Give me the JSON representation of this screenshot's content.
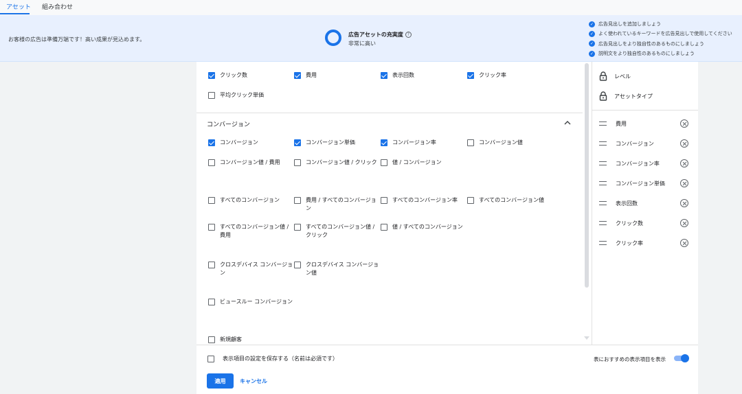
{
  "tabs": [
    {
      "label": "アセット",
      "active": true
    },
    {
      "label": "組み合わせ",
      "active": false
    }
  ],
  "banner": {
    "message": "お客様の広告は準備万端です！高い成果が見込めます。",
    "strength_title": "広告アセットの充実度",
    "help_glyph": "?",
    "strength_value": "非常に高い",
    "tips": [
      "広告見出しを追加しましょう",
      "よく使われているキーワードを広告見出しで使用してください",
      "広告見出しをより独自性のあるものにしましょう",
      "説明文をより独自性のあるものにしましょう"
    ],
    "accent_color": "#1a73e8"
  },
  "performance_metrics": [
    {
      "label": "クリック数",
      "checked": true
    },
    {
      "label": "費用",
      "checked": true
    },
    {
      "label": "表示回数",
      "checked": true
    },
    {
      "label": "クリック率",
      "checked": true
    },
    {
      "label": "平均クリック単価",
      "checked": false
    }
  ],
  "conversion_section": {
    "title": "コンバージョン",
    "expanded": true,
    "items": [
      {
        "label": "コンバージョン",
        "checked": true
      },
      {
        "label": "コンバージョン単価",
        "checked": true
      },
      {
        "label": "コンバージョン率",
        "checked": true
      },
      {
        "label": "コンバージョン値",
        "checked": false
      },
      {
        "label": "コンバージョン値 / 費用",
        "checked": false
      },
      {
        "label": "コンバージョン値 / クリック",
        "checked": false
      },
      {
        "label": "値 / コンバージョン",
        "checked": false
      },
      {
        "label": "すべてのコンバージョン",
        "checked": false
      },
      {
        "label": "費用 / すべてのコンバージョン",
        "checked": false
      },
      {
        "label": "すべてのコンバージョン率",
        "checked": false
      },
      {
        "label": "すべてのコンバージョン値",
        "checked": false
      },
      {
        "label": "すべてのコンバージョン値 / 費用",
        "checked": false
      },
      {
        "label": "すべてのコンバージョン値 / クリック",
        "checked": false
      },
      {
        "label": "値 / すべてのコンバージョン",
        "checked": false
      },
      {
        "label": "クロスデバイス コンバージョン",
        "checked": false
      },
      {
        "label": "クロスデバイス コンバージョン値",
        "checked": false
      },
      {
        "label": "ビュースルー コンバージョン",
        "checked": false
      },
      {
        "label": "新規顧客",
        "checked": false
      }
    ]
  },
  "locked_columns": [
    {
      "label": "レベル",
      "icon": "lock-icon"
    },
    {
      "label": "アセットタイプ",
      "icon": "lock-icon"
    }
  ],
  "selected_columns": [
    {
      "label": "費用"
    },
    {
      "label": "コンバージョン"
    },
    {
      "label": "コンバージョン率"
    },
    {
      "label": "コンバージョン単価"
    },
    {
      "label": "表示回数"
    },
    {
      "label": "クリック数"
    },
    {
      "label": "クリック率"
    }
  ],
  "footer": {
    "save_label": "表示項目の設定を保存する（名前は必須です）",
    "save_checked": false,
    "recommended_label": "表におすすめの表示項目を表示",
    "recommended_on": true,
    "apply_label": "適用",
    "cancel_label": "キャンセル"
  }
}
